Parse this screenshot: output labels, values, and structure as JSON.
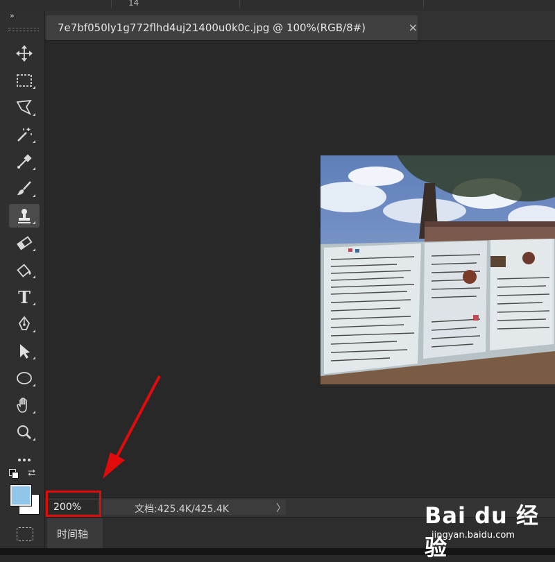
{
  "top_strip": {
    "partial_value": "14"
  },
  "document": {
    "tab_title": "7e7bf050ly1g772flhd4uj21400u0k0c.jpg @ 100%(RGB/8#)",
    "close_glyph": "×"
  },
  "toolbar": {
    "collapse_glyph": "»",
    "tools": [
      {
        "name": "move-tool-icon"
      },
      {
        "name": "marquee-tool-icon"
      },
      {
        "name": "lasso-tool-icon"
      },
      {
        "name": "magic-wand-icon"
      },
      {
        "name": "eyedropper-icon"
      },
      {
        "name": "brush-tool-icon"
      },
      {
        "name": "clone-stamp-icon",
        "active": true
      },
      {
        "name": "eraser-icon"
      },
      {
        "name": "paint-bucket-icon"
      },
      {
        "name": "type-tool-icon",
        "label": "T"
      },
      {
        "name": "pen-tool-icon"
      },
      {
        "name": "path-selection-icon"
      },
      {
        "name": "ellipse-tool-icon"
      },
      {
        "name": "hand-tool-icon"
      },
      {
        "name": "zoom-tool-icon"
      },
      {
        "name": "more-tools-icon",
        "label": "···"
      }
    ],
    "foreground_color": "#8fc6ea",
    "background_color": "#ffffff"
  },
  "status": {
    "zoom": "200%",
    "doc_info": "文档:425.4K/425.4K",
    "expand_glyph": "〉"
  },
  "timeline": {
    "tab_label": "时间轴"
  },
  "annotation": {
    "color": "#e10b0b"
  },
  "watermark": {
    "logo": "Bai du 经验",
    "url": "jingyan.baidu.com"
  }
}
